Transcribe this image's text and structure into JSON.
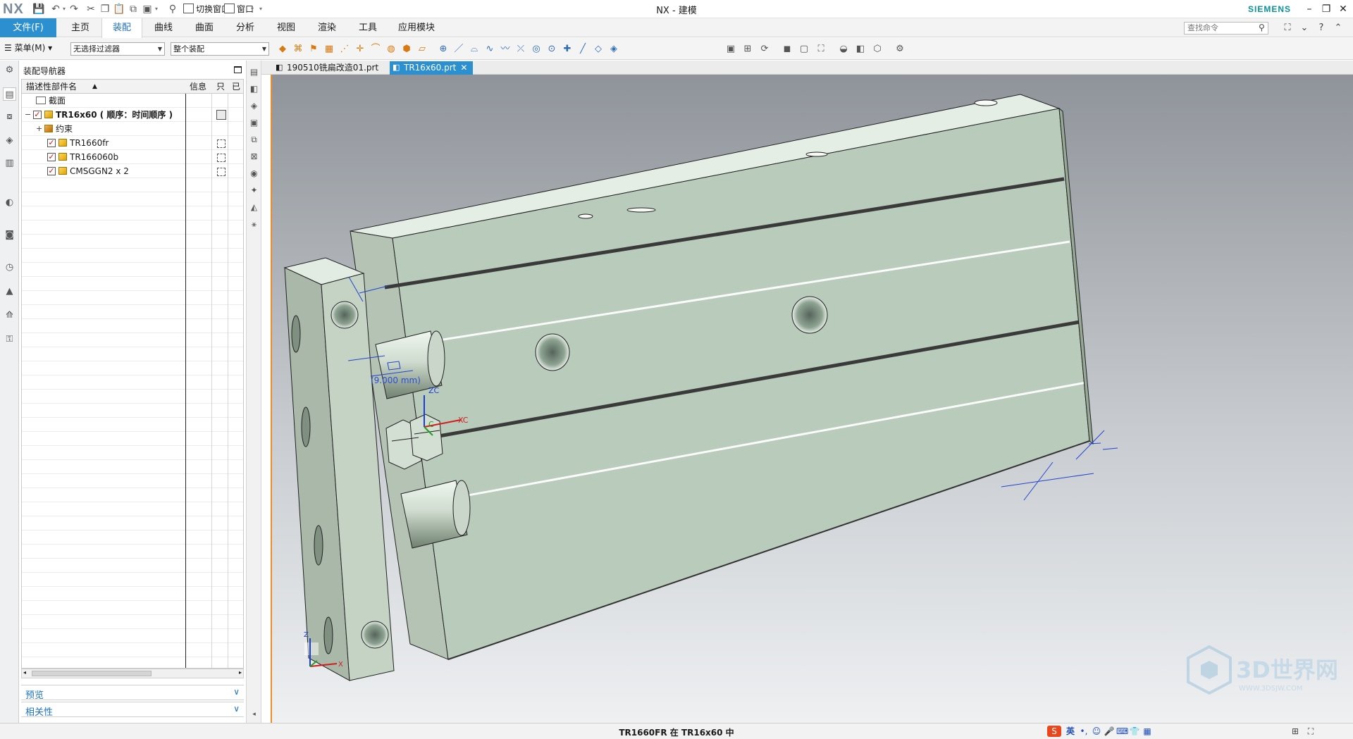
{
  "titlebar": {
    "logo": "NX",
    "window_title": "NX - 建模",
    "brand": "SIEMENS",
    "switch_window_label": "切换窗口",
    "window_menu_label": "窗口"
  },
  "ribbon": {
    "file_label": "文件(F)",
    "tabs": [
      "主页",
      "装配",
      "曲线",
      "曲面",
      "分析",
      "视图",
      "渲染",
      "工具",
      "应用模块"
    ],
    "active_tab": "装配",
    "search_placeholder": "查找命令"
  },
  "toolbar": {
    "menu_label": "菜单(M)",
    "filter_value": "无选择过滤器",
    "scope_value": "整个装配"
  },
  "navigator": {
    "title": "装配导航器",
    "columns": {
      "name": "描述性部件名",
      "info": "信息",
      "readonly": "只",
      "modified": "已"
    },
    "rows": [
      {
        "label": "截面",
        "type": "folder",
        "level": 1
      },
      {
        "label": "TR16x60 ( 顺序：时间顺序 )",
        "type": "assembly",
        "level": 0,
        "checked": true
      },
      {
        "label": "约束",
        "type": "constraints",
        "level": 1
      },
      {
        "label": "TR1660fr",
        "type": "part",
        "level": 2,
        "checked": true
      },
      {
        "label": "TR166060b",
        "type": "part",
        "level": 2,
        "checked": true
      },
      {
        "label": "CMSGGN2 x 2",
        "type": "part",
        "level": 2,
        "checked": true
      }
    ],
    "sections": [
      "预览",
      "相关性"
    ]
  },
  "documents": {
    "tabs": [
      "190510铣扁改造01.prt",
      "TR16x60.prt"
    ],
    "active": "TR16x60.prt"
  },
  "viewport": {
    "dimension_label": "(9.000 mm)",
    "axes": {
      "z": "ZC",
      "x": "XC",
      "y": "C"
    },
    "triad": {
      "z": "Z",
      "x": "X"
    },
    "watermark": "3D世界网",
    "watermark_url": "WWW.3DSJW.COM"
  },
  "statusbar": {
    "message": "TR1660FR 在 TR16x60 中",
    "ime_lang": "英"
  }
}
